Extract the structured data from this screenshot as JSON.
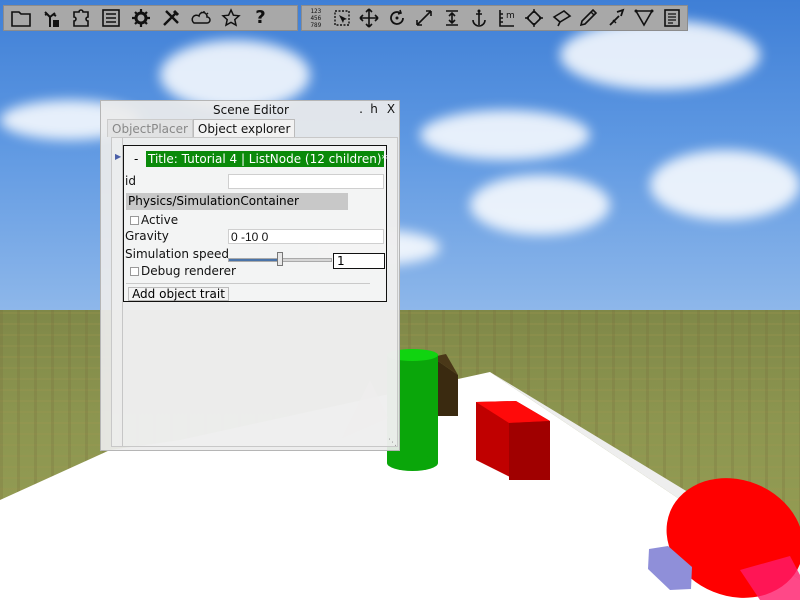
{
  "toolbar_left": {
    "buttons": [
      {
        "icon": "folder-icon"
      },
      {
        "icon": "tree-icon"
      },
      {
        "icon": "puzzle-icon"
      },
      {
        "icon": "list-icon"
      },
      {
        "icon": "gear-icon"
      },
      {
        "icon": "tools-icon"
      },
      {
        "icon": "weather-icon"
      },
      {
        "icon": "star-icon"
      },
      {
        "icon": "help-icon",
        "glyph": "?"
      }
    ]
  },
  "toolbar_right": {
    "numpad_text": "123\n456\n789",
    "buttons": [
      {
        "icon": "numpad-icon"
      },
      {
        "icon": "select-box-icon"
      },
      {
        "icon": "move-icon"
      },
      {
        "icon": "rotate-icon"
      },
      {
        "icon": "scale-icon"
      },
      {
        "icon": "snap-height-icon"
      },
      {
        "icon": "anchor-icon"
      },
      {
        "icon": "measure-icon",
        "label": "m"
      },
      {
        "icon": "light-icon"
      },
      {
        "icon": "camera-icon"
      },
      {
        "icon": "paint-icon"
      },
      {
        "icon": "wrench-icon"
      },
      {
        "icon": "vertex-icon"
      },
      {
        "icon": "document-icon"
      }
    ]
  },
  "window": {
    "title": "Scene Editor",
    "minimize_glyph": ".",
    "help_glyph": "h",
    "close_glyph": "X",
    "tabs": [
      {
        "label": "ObjectPlacer",
        "active": false
      },
      {
        "label": "Object explorer",
        "active": true
      }
    ]
  },
  "object_card": {
    "collapse_glyph": "-",
    "node_title": "Title: Tutorial 4 | ListNode (12 children)*",
    "id_label": "id",
    "id_value": "",
    "trait_name": "Physics/SimulationContainer",
    "active_label": "Active",
    "active_checked": false,
    "gravity_label": "Gravity",
    "gravity_value": "0 -10 0",
    "sim_speed_label": "Simulation speed",
    "sim_speed_value": "1",
    "sim_speed_slider_fraction": 0.5,
    "debug_label": "Debug renderer",
    "debug_checked": false,
    "add_trait_label": "Add object trait"
  },
  "colors": {
    "node_title_bg": "#0a8a0a",
    "toolbar_bg": "#a8a8a8",
    "cylinder": "#0aa60a",
    "cube_red": "#cc0000",
    "ellipsoid": "#ff0000",
    "box_lavender": "#8f8fd9",
    "cube_dark": "#3a2a10"
  }
}
